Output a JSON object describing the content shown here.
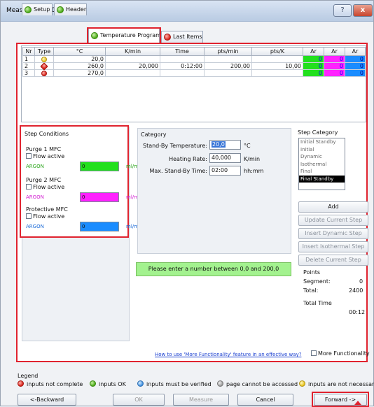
{
  "window": {
    "title": "Measurement Definition",
    "help_label": "?",
    "close_label": "x"
  },
  "tabs": [
    {
      "label": "Setup",
      "status": "ok"
    },
    {
      "label": "Header",
      "status": "ok"
    },
    {
      "label": "Temperature Program",
      "status": "ok"
    },
    {
      "label": "Last Items",
      "status": "incomplete"
    }
  ],
  "grid": {
    "headers": [
      "Nr",
      "Type",
      "°C",
      "K/min",
      "Time",
      "pts/min",
      "pts/K",
      "Ar",
      "Ar",
      "Ar"
    ],
    "rows": [
      {
        "nr": "1",
        "type_icon": "yellow-circle-icon",
        "temp": "20,0",
        "kmin": "",
        "time": "",
        "ptsmin": "",
        "ptsk": "",
        "ar1": "0",
        "ar2": "0",
        "ar3": "0"
      },
      {
        "nr": "2",
        "type_icon": "red-dynamic-icon",
        "temp": "260,0",
        "kmin": "20,000",
        "time": "0:12:00",
        "ptsmin": "200,00",
        "ptsk": "10,00",
        "ar1": "0",
        "ar2": "0",
        "ar3": "0"
      },
      {
        "nr": "3",
        "type_icon": "red-final-icon",
        "temp": "270,0",
        "kmin": "",
        "time": "",
        "ptsmin": "",
        "ptsk": "",
        "ar1": "0",
        "ar2": "0",
        "ar3": "0"
      }
    ]
  },
  "step_conditions": {
    "title": "Step Conditions",
    "mfcs": [
      {
        "name": "Purge 1 MFC",
        "flow_label": "Flow active",
        "gas": "ARGON",
        "value": "0",
        "unit": "ml/min",
        "color": "#22e01e",
        "text_color": "#2aa51a"
      },
      {
        "name": "Purge 2 MFC",
        "flow_label": "Flow active",
        "gas": "ARGON",
        "value": "0",
        "unit": "ml/min",
        "color": "#ff22ff",
        "text_color": "#d21ed2"
      },
      {
        "name": "Protective MFC",
        "flow_label": "Flow active",
        "gas": "ARGON",
        "value": "0",
        "unit": "ml/min",
        "color": "#1a8cff",
        "text_color": "#1a6ad8"
      }
    ]
  },
  "category": {
    "title": "Category",
    "standby_temp_label": "Stand-By Temperature:",
    "standby_temp_value": "20,0",
    "standby_temp_unit": "°C",
    "heating_rate_label": "Heating Rate:",
    "heating_rate_value": "40,000",
    "heating_rate_unit": "K/min",
    "max_standby_label": "Max. Stand-By Time:",
    "max_standby_value": "02:00",
    "max_standby_unit": "hh:mm"
  },
  "message": "Please enter a number between 0,0 and 200,0",
  "step_category": {
    "title": "Step Category",
    "items": [
      "Initial Standby",
      "Initial",
      "Dynamic",
      "Isothermal",
      "Final",
      "Final Standby"
    ],
    "selected": "Final Standby"
  },
  "step_buttons": {
    "add": "Add",
    "update": "Update Current Step",
    "insert_dynamic": "Insert Dynamic Step",
    "insert_isothermal": "Insert Isothermal Step",
    "delete": "Delete Current Step"
  },
  "points": {
    "title": "Points",
    "segment_label": "Segment:",
    "segment_value": "0",
    "total_label": "Total:",
    "total_value": "2400",
    "total_time_label": "Total Time",
    "total_time_value": "00:12"
  },
  "help_link": "How to use 'More Functionality' feature in an effective way?",
  "more_functionality_label": "More Functionality",
  "legend": {
    "title": "Legend",
    "items": [
      {
        "icon": "red-status-icon",
        "label": "inputs not complete"
      },
      {
        "icon": "green-status-icon",
        "label": "inputs OK"
      },
      {
        "icon": "blue-status-icon",
        "label": "inputs must be verified"
      },
      {
        "icon": "grey-status-icon",
        "label": "page cannot be accessed"
      },
      {
        "icon": "yellow-status-icon",
        "label": "inputs are not necessary"
      }
    ]
  },
  "footer": {
    "backward": "<-Backward",
    "ok": "OK",
    "measure": "Measure",
    "cancel": "Cancel",
    "forward": "Forward ->"
  }
}
